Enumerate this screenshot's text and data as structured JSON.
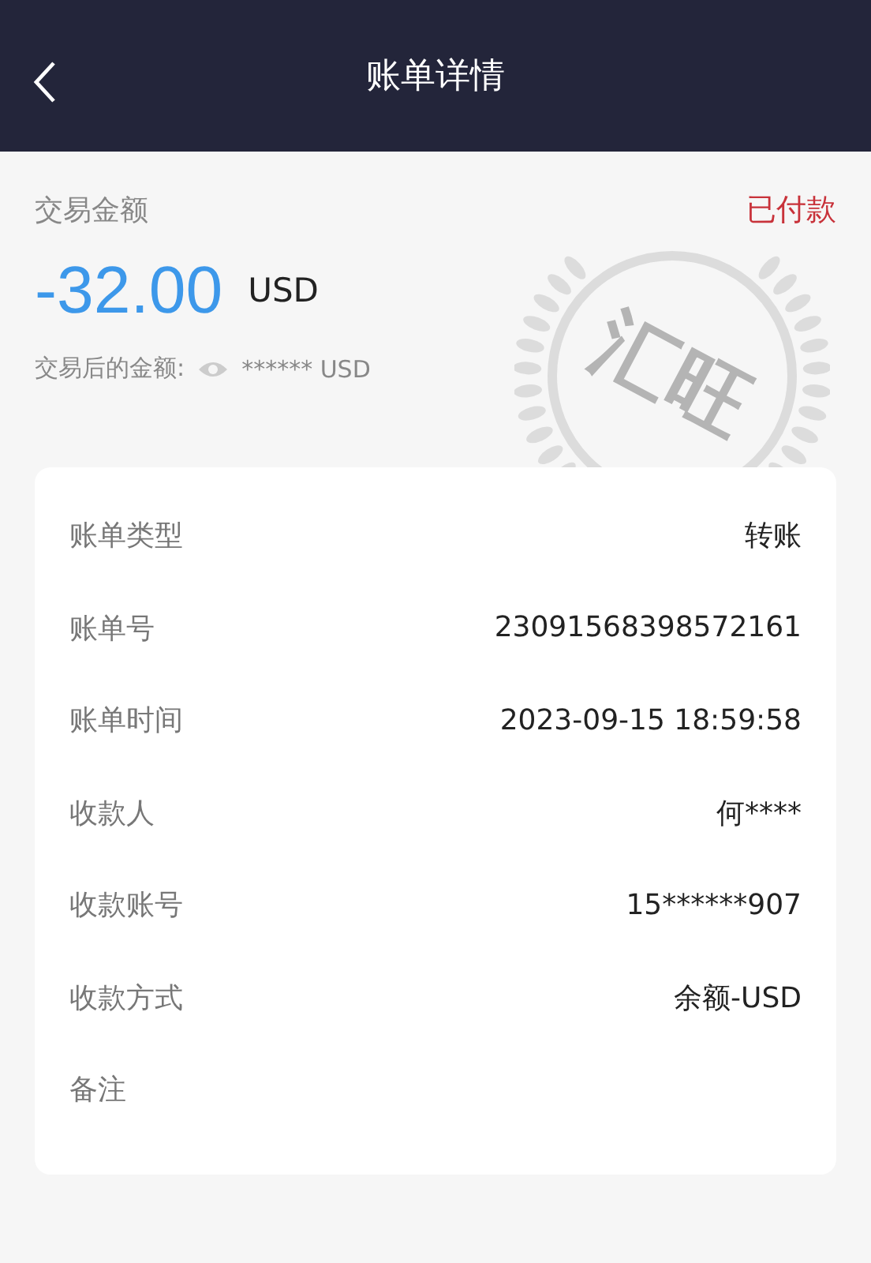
{
  "header": {
    "title": "账单详情"
  },
  "summary": {
    "label": "交易金额",
    "status": "已付款",
    "amount": "-32.00",
    "currency": "USD",
    "balance_label": "交易后的金额:",
    "balance_value": "****** USD",
    "seal_text": "汇旺"
  },
  "details": [
    {
      "label": "账单类型",
      "value": "转账"
    },
    {
      "label": "账单号",
      "value": "23091568398572161"
    },
    {
      "label": "账单时间",
      "value": "2023-09-15 18:59:58"
    },
    {
      "label": "收款人",
      "value": "何****"
    },
    {
      "label": "收款账号",
      "value": "15******907"
    },
    {
      "label": "收款方式",
      "value": "余额-USD"
    },
    {
      "label": "备注"
    }
  ]
}
